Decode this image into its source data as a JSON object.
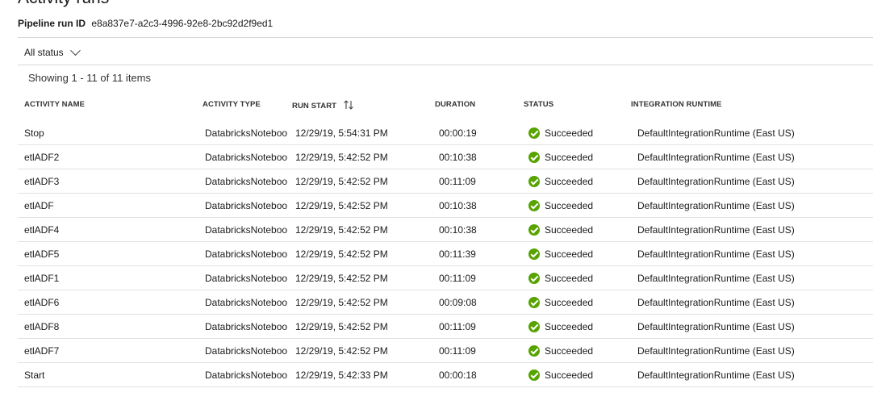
{
  "header": {
    "title": "Activity runs",
    "run_id_label": "Pipeline run ID",
    "run_id_value": "e8a837e7-a2c3-4996-92e8-2bc92d2f9ed1"
  },
  "filter": {
    "status_label": "All status"
  },
  "summary": {
    "showing_text": "Showing 1 - 11 of 11 items"
  },
  "columns": {
    "activity_name": "ACTIVITY NAME",
    "activity_type": "ACTIVITY TYPE",
    "run_start": "RUN START",
    "duration": "DURATION",
    "status": "STATUS",
    "integration_runtime": "INTEGRATION RUNTIME"
  },
  "rows": [
    {
      "name": "Stop",
      "type": "DatabricksNoteboo",
      "start": "12/29/19, 5:54:31 PM",
      "duration": "00:00:19",
      "status": "Succeeded",
      "runtime": "DefaultIntegrationRuntime (East US)"
    },
    {
      "name": "etlADF2",
      "type": "DatabricksNoteboo",
      "start": "12/29/19, 5:42:52 PM",
      "duration": "00:10:38",
      "status": "Succeeded",
      "runtime": "DefaultIntegrationRuntime (East US)"
    },
    {
      "name": "etlADF3",
      "type": "DatabricksNoteboo",
      "start": "12/29/19, 5:42:52 PM",
      "duration": "00:11:09",
      "status": "Succeeded",
      "runtime": "DefaultIntegrationRuntime (East US)"
    },
    {
      "name": "etlADF",
      "type": "DatabricksNoteboo",
      "start": "12/29/19, 5:42:52 PM",
      "duration": "00:10:38",
      "status": "Succeeded",
      "runtime": "DefaultIntegrationRuntime (East US)"
    },
    {
      "name": "etlADF4",
      "type": "DatabricksNoteboo",
      "start": "12/29/19, 5:42:52 PM",
      "duration": "00:10:38",
      "status": "Succeeded",
      "runtime": "DefaultIntegrationRuntime (East US)"
    },
    {
      "name": "etlADF5",
      "type": "DatabricksNoteboo",
      "start": "12/29/19, 5:42:52 PM",
      "duration": "00:11:39",
      "status": "Succeeded",
      "runtime": "DefaultIntegrationRuntime (East US)"
    },
    {
      "name": "etlADF1",
      "type": "DatabricksNoteboo",
      "start": "12/29/19, 5:42:52 PM",
      "duration": "00:11:09",
      "status": "Succeeded",
      "runtime": "DefaultIntegrationRuntime (East US)"
    },
    {
      "name": "etlADF6",
      "type": "DatabricksNoteboo",
      "start": "12/29/19, 5:42:52 PM",
      "duration": "00:09:08",
      "status": "Succeeded",
      "runtime": "DefaultIntegrationRuntime (East US)"
    },
    {
      "name": "etlADF8",
      "type": "DatabricksNoteboo",
      "start": "12/29/19, 5:42:52 PM",
      "duration": "00:11:09",
      "status": "Succeeded",
      "runtime": "DefaultIntegrationRuntime (East US)"
    },
    {
      "name": "etlADF7",
      "type": "DatabricksNoteboo",
      "start": "12/29/19, 5:42:52 PM",
      "duration": "00:11:09",
      "status": "Succeeded",
      "runtime": "DefaultIntegrationRuntime (East US)"
    },
    {
      "name": "Start",
      "type": "DatabricksNoteboo",
      "start": "12/29/19, 5:42:33 PM",
      "duration": "00:00:18",
      "status": "Succeeded",
      "runtime": "DefaultIntegrationRuntime (East US)"
    }
  ],
  "icons": {
    "status_filter": "chevron-down-icon",
    "sort": "sort-arrows-icon",
    "succeeded": "check-circle-icon"
  },
  "colors": {
    "succeeded": "#57a300",
    "divider": "#d6d6d6"
  }
}
